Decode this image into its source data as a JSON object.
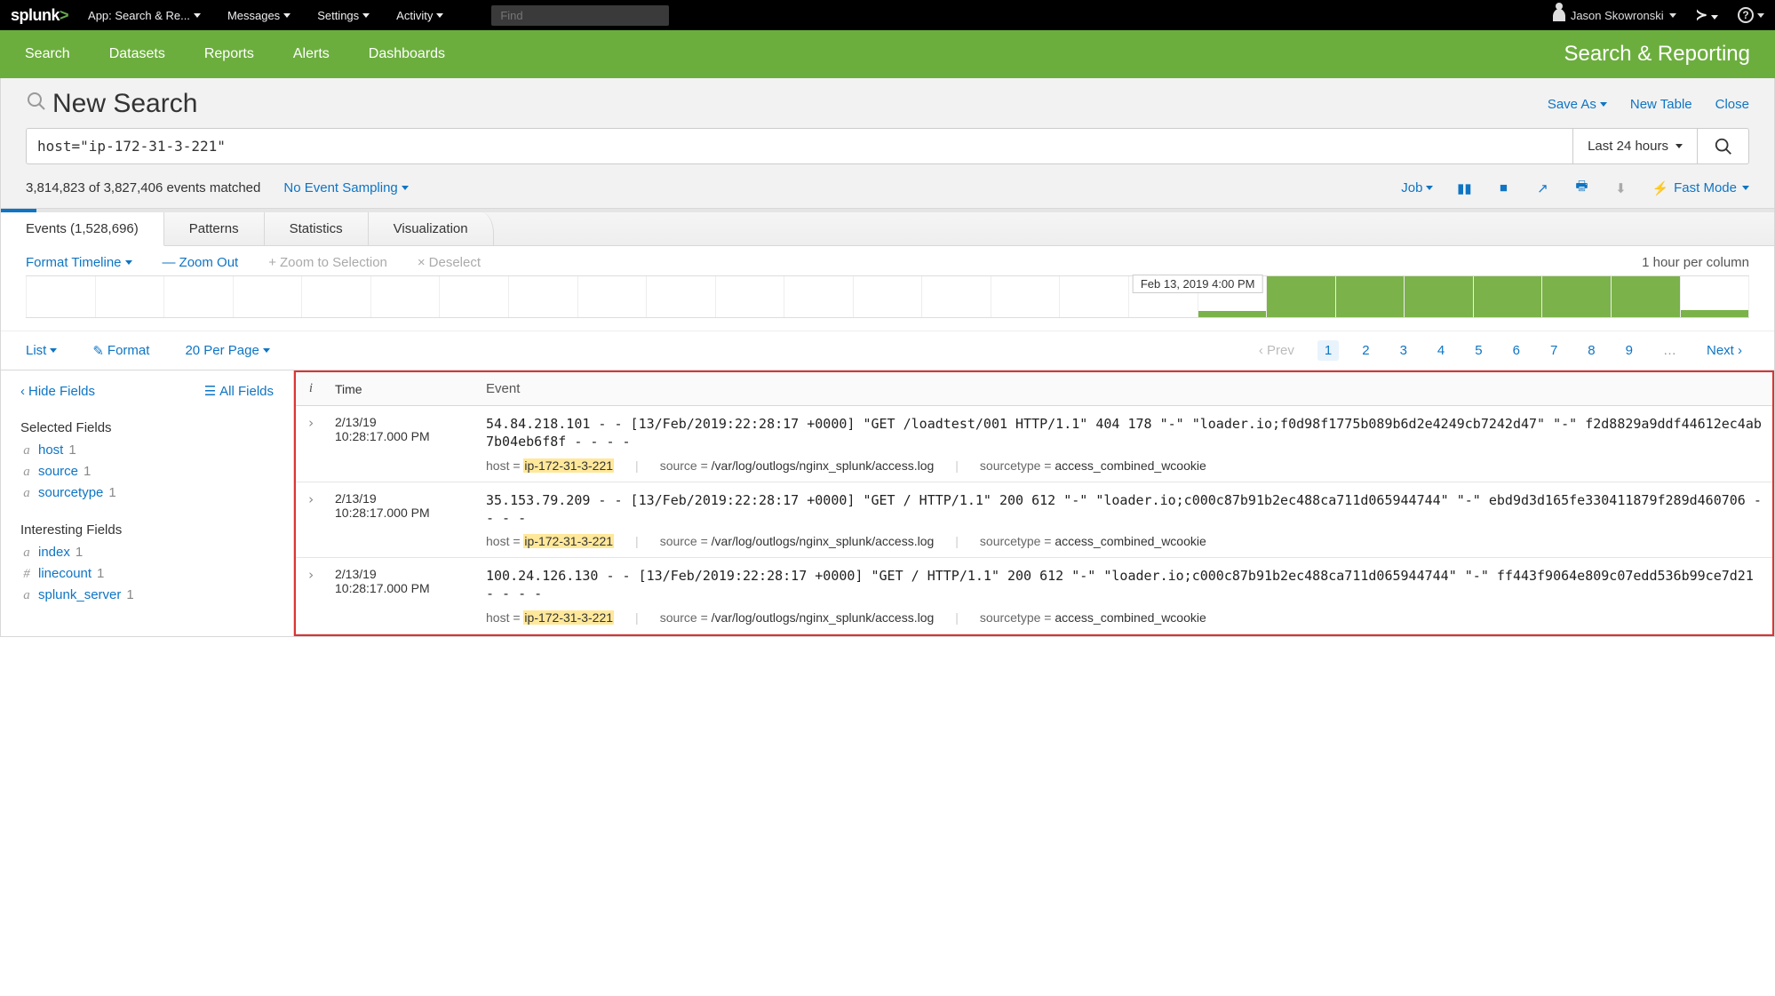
{
  "topbar": {
    "logo": "splunk",
    "app_label": "App: Search & Re...",
    "menus": {
      "messages": "Messages",
      "settings": "Settings",
      "activity": "Activity"
    },
    "find_placeholder": "Find",
    "username": "Jason Skowronski"
  },
  "greenbar": {
    "tabs": {
      "search": "Search",
      "datasets": "Datasets",
      "reports": "Reports",
      "alerts": "Alerts",
      "dashboards": "Dashboards"
    },
    "title": "Search & Reporting"
  },
  "header": {
    "page_title": "New Search",
    "actions": {
      "saveas": "Save As",
      "newtable": "New Table",
      "close": "Close"
    },
    "query": "host=\"ip-172-31-3-221\"",
    "timerange": "Last 24 hours"
  },
  "status": {
    "text": "3,814,823 of 3,827,406 events matched",
    "sampling": "No Event Sampling",
    "job": "Job",
    "fastmode": "Fast Mode",
    "progress_pct": 2
  },
  "viewtabs": {
    "events": "Events (1,528,696)",
    "patterns": "Patterns",
    "statistics": "Statistics",
    "visualization": "Visualization"
  },
  "timeline": {
    "format": "Format Timeline",
    "zoomout": "Zoom Out",
    "zoomsel": "Zoom to Selection",
    "deselect": "Deselect",
    "percol": "1 hour per column",
    "tip": "Feb 13, 2019 4:00 PM",
    "bars": [
      0,
      0,
      0,
      0,
      0,
      0,
      0,
      0,
      0,
      0,
      0,
      0,
      0,
      0,
      0,
      0,
      0,
      16,
      100,
      100,
      100,
      100,
      100,
      100,
      18
    ]
  },
  "listbar": {
    "list": "List",
    "format": "Format",
    "perpage": "20 Per Page",
    "prev": "Prev",
    "pages": [
      "1",
      "2",
      "3",
      "4",
      "5",
      "6",
      "7",
      "8",
      "9"
    ],
    "next": "Next"
  },
  "sidebar": {
    "hidefields": "Hide Fields",
    "allfields": "All Fields",
    "selected_h": "Selected Fields",
    "interesting_h": "Interesting Fields",
    "selected": [
      {
        "pre": "a",
        "name": "host",
        "count": "1"
      },
      {
        "pre": "a",
        "name": "source",
        "count": "1"
      },
      {
        "pre": "a",
        "name": "sourcetype",
        "count": "1"
      }
    ],
    "interesting": [
      {
        "pre": "a",
        "name": "index",
        "count": "1"
      },
      {
        "pre": "#",
        "name": "linecount",
        "count": "1"
      },
      {
        "pre": "a",
        "name": "splunk_server",
        "count": "1"
      }
    ]
  },
  "cols": {
    "i": "i",
    "time": "Time",
    "event": "Event"
  },
  "events": [
    {
      "date": "2/13/19",
      "time": "10:28:17.000 PM",
      "raw": "54.84.218.101 - - [13/Feb/2019:22:28:17 +0000] \"GET /loadtest/001 HTTP/1.1\" 404 178 \"-\" \"loader.io;f0d98f1775b089b6d2e4249cb7242d47\" \"-\" f2d8829a9ddf44612ec4ab7b04eb6f8f - - - -",
      "host": "ip-172-31-3-221",
      "source": "/var/log/outlogs/nginx_splunk/access.log",
      "sourcetype": "access_combined_wcookie"
    },
    {
      "date": "2/13/19",
      "time": "10:28:17.000 PM",
      "raw": "35.153.79.209 - - [13/Feb/2019:22:28:17 +0000] \"GET / HTTP/1.1\" 200 612 \"-\" \"loader.io;c000c87b91b2ec488ca711d065944744\" \"-\" ebd9d3d165fe330411879f289d460706 - - - -",
      "host": "ip-172-31-3-221",
      "source": "/var/log/outlogs/nginx_splunk/access.log",
      "sourcetype": "access_combined_wcookie"
    },
    {
      "date": "2/13/19",
      "time": "10:28:17.000 PM",
      "raw": "100.24.126.130 - - [13/Feb/2019:22:28:17 +0000] \"GET / HTTP/1.1\" 200 612 \"-\" \"loader.io;c000c87b91b2ec488ca711d065944744\" \"-\" ff443f9064e809c07edd536b99ce7d21 - - - -",
      "host": "ip-172-31-3-221",
      "source": "/var/log/outlogs/nginx_splunk/access.log",
      "sourcetype": "access_combined_wcookie"
    }
  ],
  "meta_labels": {
    "host": "host = ",
    "source": "source = ",
    "sourcetype": "sourcetype = "
  }
}
